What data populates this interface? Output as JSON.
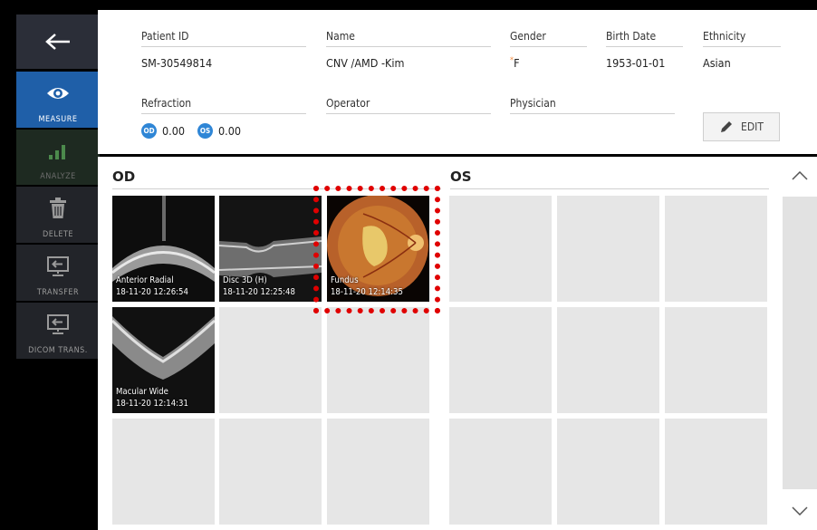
{
  "sidebar": {
    "back_label": "",
    "items": [
      {
        "label": "MEASURE",
        "icon": "eye-icon"
      },
      {
        "label": "ANALYZE",
        "icon": "bar-chart-icon"
      },
      {
        "label": "DELETE",
        "icon": "trash-icon"
      },
      {
        "label": "TRANSFER",
        "icon": "transfer-monitor-icon"
      },
      {
        "label": "DICOM TRANS.",
        "icon": "dicom-monitor-icon"
      }
    ]
  },
  "patient": {
    "id_label": "Patient ID",
    "id_value": "SM-30549814",
    "name_label": "Name",
    "name_value": "CNV /AMD -Kim",
    "gender_label": "Gender",
    "gender_marker": "*",
    "gender_value": "F",
    "birth_label": "Birth Date",
    "birth_value": "1953-01-01",
    "ethnicity_label": "Ethnicity",
    "ethnicity_value": "Asian",
    "refraction_label": "Refraction",
    "od_badge": "OD",
    "od_value": "0.00",
    "os_badge": "OS",
    "os_value": "0.00",
    "operator_label": "Operator",
    "operator_value": "",
    "physician_label": "Physician",
    "physician_value": "",
    "edit_label": "EDIT"
  },
  "od": {
    "title": "OD",
    "thumbnails": [
      {
        "name": "Anterior Radial",
        "date": "18-11-20 12:26:54"
      },
      {
        "name": "Disc 3D (H)",
        "date": "18-11-20 12:25:48"
      },
      {
        "name": "Fundus",
        "date": "18-11-20 12:14:35"
      },
      {
        "name": "Macular Wide",
        "date": "18-11-20 12:14:31"
      }
    ]
  },
  "os": {
    "title": "OS"
  },
  "colors": {
    "accent": "#1f5fa8",
    "highlight": "#e00000",
    "badge": "#2f86d6"
  }
}
